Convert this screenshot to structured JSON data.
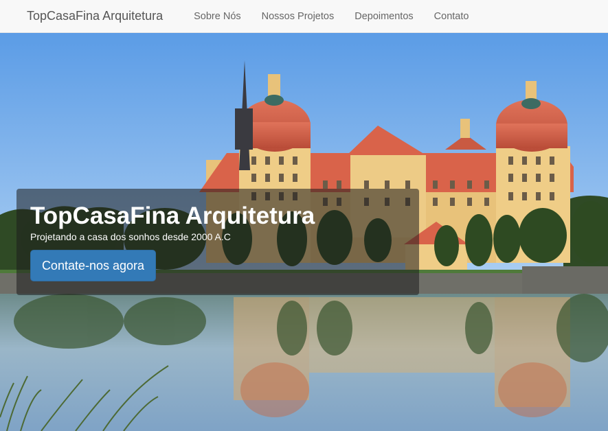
{
  "navbar": {
    "brand": "TopCasaFina Arquitetura",
    "links": [
      {
        "label": "Sobre Nós"
      },
      {
        "label": "Nossos Projetos"
      },
      {
        "label": "Depoimentos"
      },
      {
        "label": "Contato"
      }
    ]
  },
  "hero": {
    "title": "TopCasaFina Arquitetura",
    "subtitle": "Projetando a casa dos sonhos desde 2000 A.C",
    "cta_label": "Contate-nos agora"
  },
  "colors": {
    "navbar_bg": "#f8f8f8",
    "button": "#337ab7",
    "sky": "#6ea8e8",
    "roof": "#d9634a",
    "wall": "#e8c27a"
  }
}
